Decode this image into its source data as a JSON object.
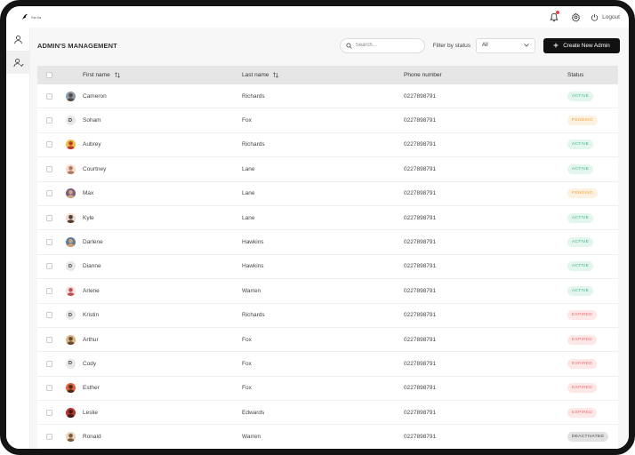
{
  "app": {
    "logo_text": "Serlia"
  },
  "topbar": {
    "logout_label": "Logout",
    "notification_dot_color": "#e94545"
  },
  "page": {
    "title": "ADMIN'S MANAGEMENT"
  },
  "search": {
    "placeholder": "Search..."
  },
  "filter": {
    "label": "Filter by status",
    "selected": "All"
  },
  "create_button": {
    "label": "Create New Admin"
  },
  "table": {
    "headers": {
      "first_name": "First name",
      "last_name": "Last name",
      "phone": "Phone number",
      "status": "Status"
    },
    "rows": [
      {
        "first": "Cameron",
        "last": "Richards",
        "phone": "0227898791",
        "status": "ACTIVE",
        "status_type": "active",
        "avatar": {
          "type": "photo",
          "bg": "#8a9bb0",
          "fg": "#5b4a3a"
        }
      },
      {
        "first": "Soham",
        "last": "Fox",
        "phone": "0227898791",
        "status": "PENDING",
        "status_type": "pending",
        "avatar": {
          "type": "letter",
          "letter": "D"
        }
      },
      {
        "first": "Aubrey",
        "last": "Richards",
        "phone": "0227898791",
        "status": "ACTIVE",
        "status_type": "active",
        "avatar": {
          "type": "photo",
          "bg": "#e8c14a",
          "fg": "#c0392b"
        }
      },
      {
        "first": "Courtney",
        "last": "Lane",
        "phone": "0227898791",
        "status": "ACTIVE",
        "status_type": "active",
        "avatar": {
          "type": "photo",
          "bg": "#f2ddd0",
          "fg": "#b07a5a"
        }
      },
      {
        "first": "Max",
        "last": "Lane",
        "phone": "0227898791",
        "status": "PENDING",
        "status_type": "pending",
        "avatar": {
          "type": "photo",
          "bg": "#7a5c86",
          "fg": "#d4a47a"
        }
      },
      {
        "first": "Kyle",
        "last": "Lane",
        "phone": "0227898791",
        "status": "ACTIVE",
        "status_type": "active",
        "avatar": {
          "type": "photo",
          "bg": "#e9ddd2",
          "fg": "#5a3a2a"
        }
      },
      {
        "first": "Darlene",
        "last": "Hawkins",
        "phone": "0227898791",
        "status": "ACTIVE",
        "status_type": "active",
        "avatar": {
          "type": "photo",
          "bg": "#5b7fa0",
          "fg": "#d6a070"
        }
      },
      {
        "first": "Dianne",
        "last": "Hawkins",
        "phone": "0227898791",
        "status": "ACTIVE",
        "status_type": "active",
        "avatar": {
          "type": "letter",
          "letter": "D"
        }
      },
      {
        "first": "Arlene",
        "last": "Warren",
        "phone": "0227898791",
        "status": "ACTIVE",
        "status_type": "active",
        "avatar": {
          "type": "photo",
          "bg": "#f4e1e1",
          "fg": "#c0504d"
        }
      },
      {
        "first": "Kristin",
        "last": "Richards",
        "phone": "0227898791",
        "status": "EXPIRED",
        "status_type": "expired",
        "avatar": {
          "type": "letter",
          "letter": "D"
        }
      },
      {
        "first": "Arthur",
        "last": "Fox",
        "phone": "0227898791",
        "status": "EXPIRED",
        "status_type": "expired",
        "avatar": {
          "type": "photo",
          "bg": "#d9b78c",
          "fg": "#6b4a2b"
        }
      },
      {
        "first": "Cody",
        "last": "Fox",
        "phone": "0227898791",
        "status": "EXPIRED",
        "status_type": "expired",
        "avatar": {
          "type": "letter",
          "letter": "D"
        }
      },
      {
        "first": "Esther",
        "last": "Fox",
        "phone": "0227898791",
        "status": "EXPIRED",
        "status_type": "expired",
        "avatar": {
          "type": "photo",
          "bg": "#e0603a",
          "fg": "#4a2a1a"
        }
      },
      {
        "first": "Leslie",
        "last": "Edwards",
        "phone": "0227898791",
        "status": "EXPIRED",
        "status_type": "expired",
        "avatar": {
          "type": "photo",
          "bg": "#b8352e",
          "fg": "#3a1a1a"
        }
      },
      {
        "first": "Ronald",
        "last": "Warren",
        "phone": "0227898791",
        "status": "DEACTIVATED",
        "status_type": "deactivated",
        "avatar": {
          "type": "photo",
          "bg": "#e8d6c0",
          "fg": "#7a5a3a"
        }
      }
    ]
  }
}
